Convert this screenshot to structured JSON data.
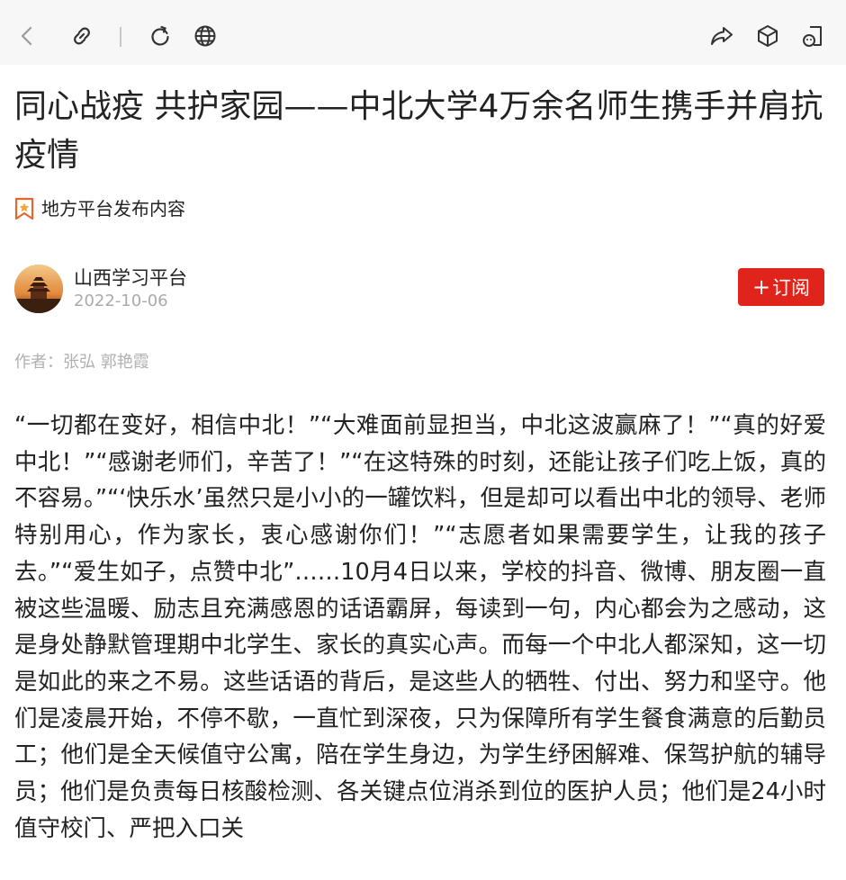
{
  "toolbar": {
    "icons": [
      "back-icon",
      "link-icon",
      "refresh-icon",
      "globe-icon",
      "share-icon",
      "cube-icon",
      "mini-program-icon"
    ]
  },
  "article": {
    "title": "同心战疫 共护家园——中北大学4万余名师生携手并肩抗疫情",
    "source_label": "地方平台发布内容",
    "publisher": "山西学习平台",
    "date": "2022-10-06",
    "subscribe_label": "订阅",
    "subscribe_plus": "+",
    "byline": "作者：张弘 郭艳霞",
    "body": "“一切都在变好，相信中北！”“大难面前显担当，中北这波赢麻了！”“真的好爱中北！”“感谢老师们，辛苦了！”“在这特殊的时刻，还能让孩子们吃上饭，真的不容易。”“‘快乐水’虽然只是小小的一罐饮料，但是却可以看出中北的领导、老师特别用心，作为家长，衷心感谢你们！”“志愿者如果需要学生，让我的孩子去。”“爱生如子，点赞中北”……10月4日以来，学校的抖音、微博、朋友圈一直被这些温暖、励志且充满感恩的话语霸屏，每读到一句，内心都会为之感动，这是身处静默管理期中北学生、家长的真实心声。而每一个中北人都深知，这一切是如此的来之不易。这些话语的背后，是这些人的牺牲、付出、努力和坚守。他们是凌晨开始，不停不歇，一直忙到深夜，只为保障所有学生餐食满意的后勤员工；他们是全天候值守公寓，陪在学生身边，为学生纾困解难、保驾护航的辅导员；他们是负责每日核酸检测、各关键点位消杀到位的医护人员；他们是24小时值守校门、严把入口关"
  },
  "colors": {
    "accent": "#e0231b",
    "muted": "#aaaaaa",
    "toolbar_bg": "#f7f7f7"
  }
}
